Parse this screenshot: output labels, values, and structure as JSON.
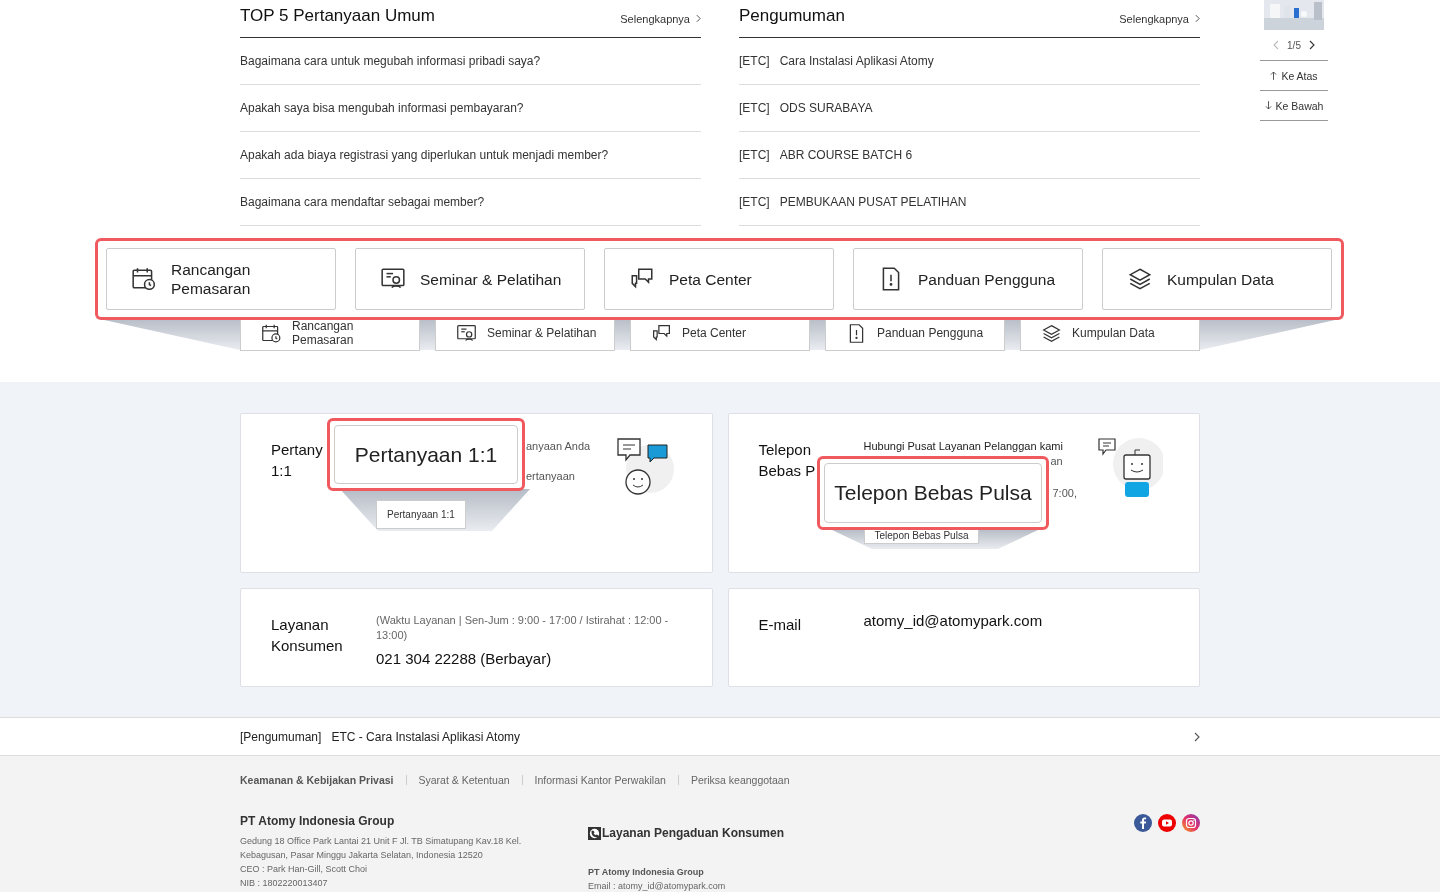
{
  "faq": {
    "title": "TOP 5 Pertanyaan Umum",
    "more": "Selengkapnya",
    "items": [
      "Bagaimana cara untuk megubah informasi pribadi saya?",
      "Apakah saya bisa mengubah informasi pembayaran?",
      "Apakah ada biaya registrasi yang diperlukan untuk menjadi member?",
      "Bagaimana cara mendaftar sebagai member?"
    ]
  },
  "announcements": {
    "title": "Pengumuman",
    "more": "Selengkapnya",
    "items": [
      {
        "tag": "[ETC]",
        "text": "Cara Instalasi Aplikasi Atomy"
      },
      {
        "tag": "[ETC]",
        "text": "ODS SURABAYA"
      },
      {
        "tag": "[ETC]",
        "text": "ABR COURSE BATCH 6"
      },
      {
        "tag": "[ETC]",
        "text": "PEMBUKAAN PUSAT PELATIHAN"
      }
    ]
  },
  "side_nav": {
    "pager": "1/5",
    "up": "Ke Atas",
    "down": "Ke Bawah"
  },
  "quick_links_zoom": [
    "Rancangan\nPemasaran",
    "Seminar & Pelatihan",
    "Peta Center",
    "Panduan Pengguna",
    "Kumpulan Data"
  ],
  "quick_links": [
    "Rancangan\nPemasaran",
    "Seminar & Pelatihan",
    "Peta Center",
    "Panduan Pengguna",
    "Kumpulan Data"
  ],
  "contact_cards": [
    {
      "kind": "inquiry",
      "title": [
        "Pertany",
        "1:1"
      ],
      "fragments": [
        "anyaan Anda",
        "ertanyaan"
      ],
      "button": "Pertanyaan 1:1",
      "zoom_label": "Pertanyaan 1:1"
    },
    {
      "kind": "tollfree",
      "title": [
        "Telepon",
        "Bebas P"
      ],
      "fragments": [
        "Hubungi Pusat Layanan Pelanggan kami",
        "an",
        "7:00,"
      ],
      "button": "Telepon Bebas Pulsa",
      "zoom_label": "Telepon Bebas Pulsa"
    },
    {
      "kind": "service",
      "title": [
        "Layanan",
        "Konsumen"
      ],
      "note": "(Waktu Layanan | Sen-Jum : 9:00 - 17:00 / Istirahat : 12:00 - 13:00)",
      "phone": "021 304 22288 (Berbayar)"
    },
    {
      "kind": "email",
      "title": [
        "E-mail"
      ],
      "email": "atomy_id@atomypark.com"
    }
  ],
  "notice_bar": {
    "tag": "[Pengumuman]",
    "text": "ETC - Cara Instalasi Aplikasi Atomy"
  },
  "footer": {
    "links": [
      {
        "label": "Keamanan & Kebijakan Privasi",
        "bold": true
      },
      {
        "label": "Syarat & Ketentuan",
        "bold": false
      },
      {
        "label": "Informasi Kantor Perwakilan",
        "bold": false
      },
      {
        "label": "Periksa keanggotaan",
        "bold": false
      }
    ],
    "company": {
      "name": "PT Atomy Indonesia Group",
      "lines": [
        "Gedung 18 Office Park Lantai 21 Unit F Jl. TB Simatupang Kav.18 Kel.",
        "Kebagusan, Pasar Minggu Jakarta Selatan, Indonesia 12520",
        "CEO : Park Han-Gill, Scott Choi",
        "NIB : 1802220013407"
      ]
    },
    "complaint": {
      "title": "Layanan Pengaduan Konsumen",
      "company": "PT Atomy Indonesia Group",
      "email": "Email : atomy_id@atomypark.com"
    }
  }
}
